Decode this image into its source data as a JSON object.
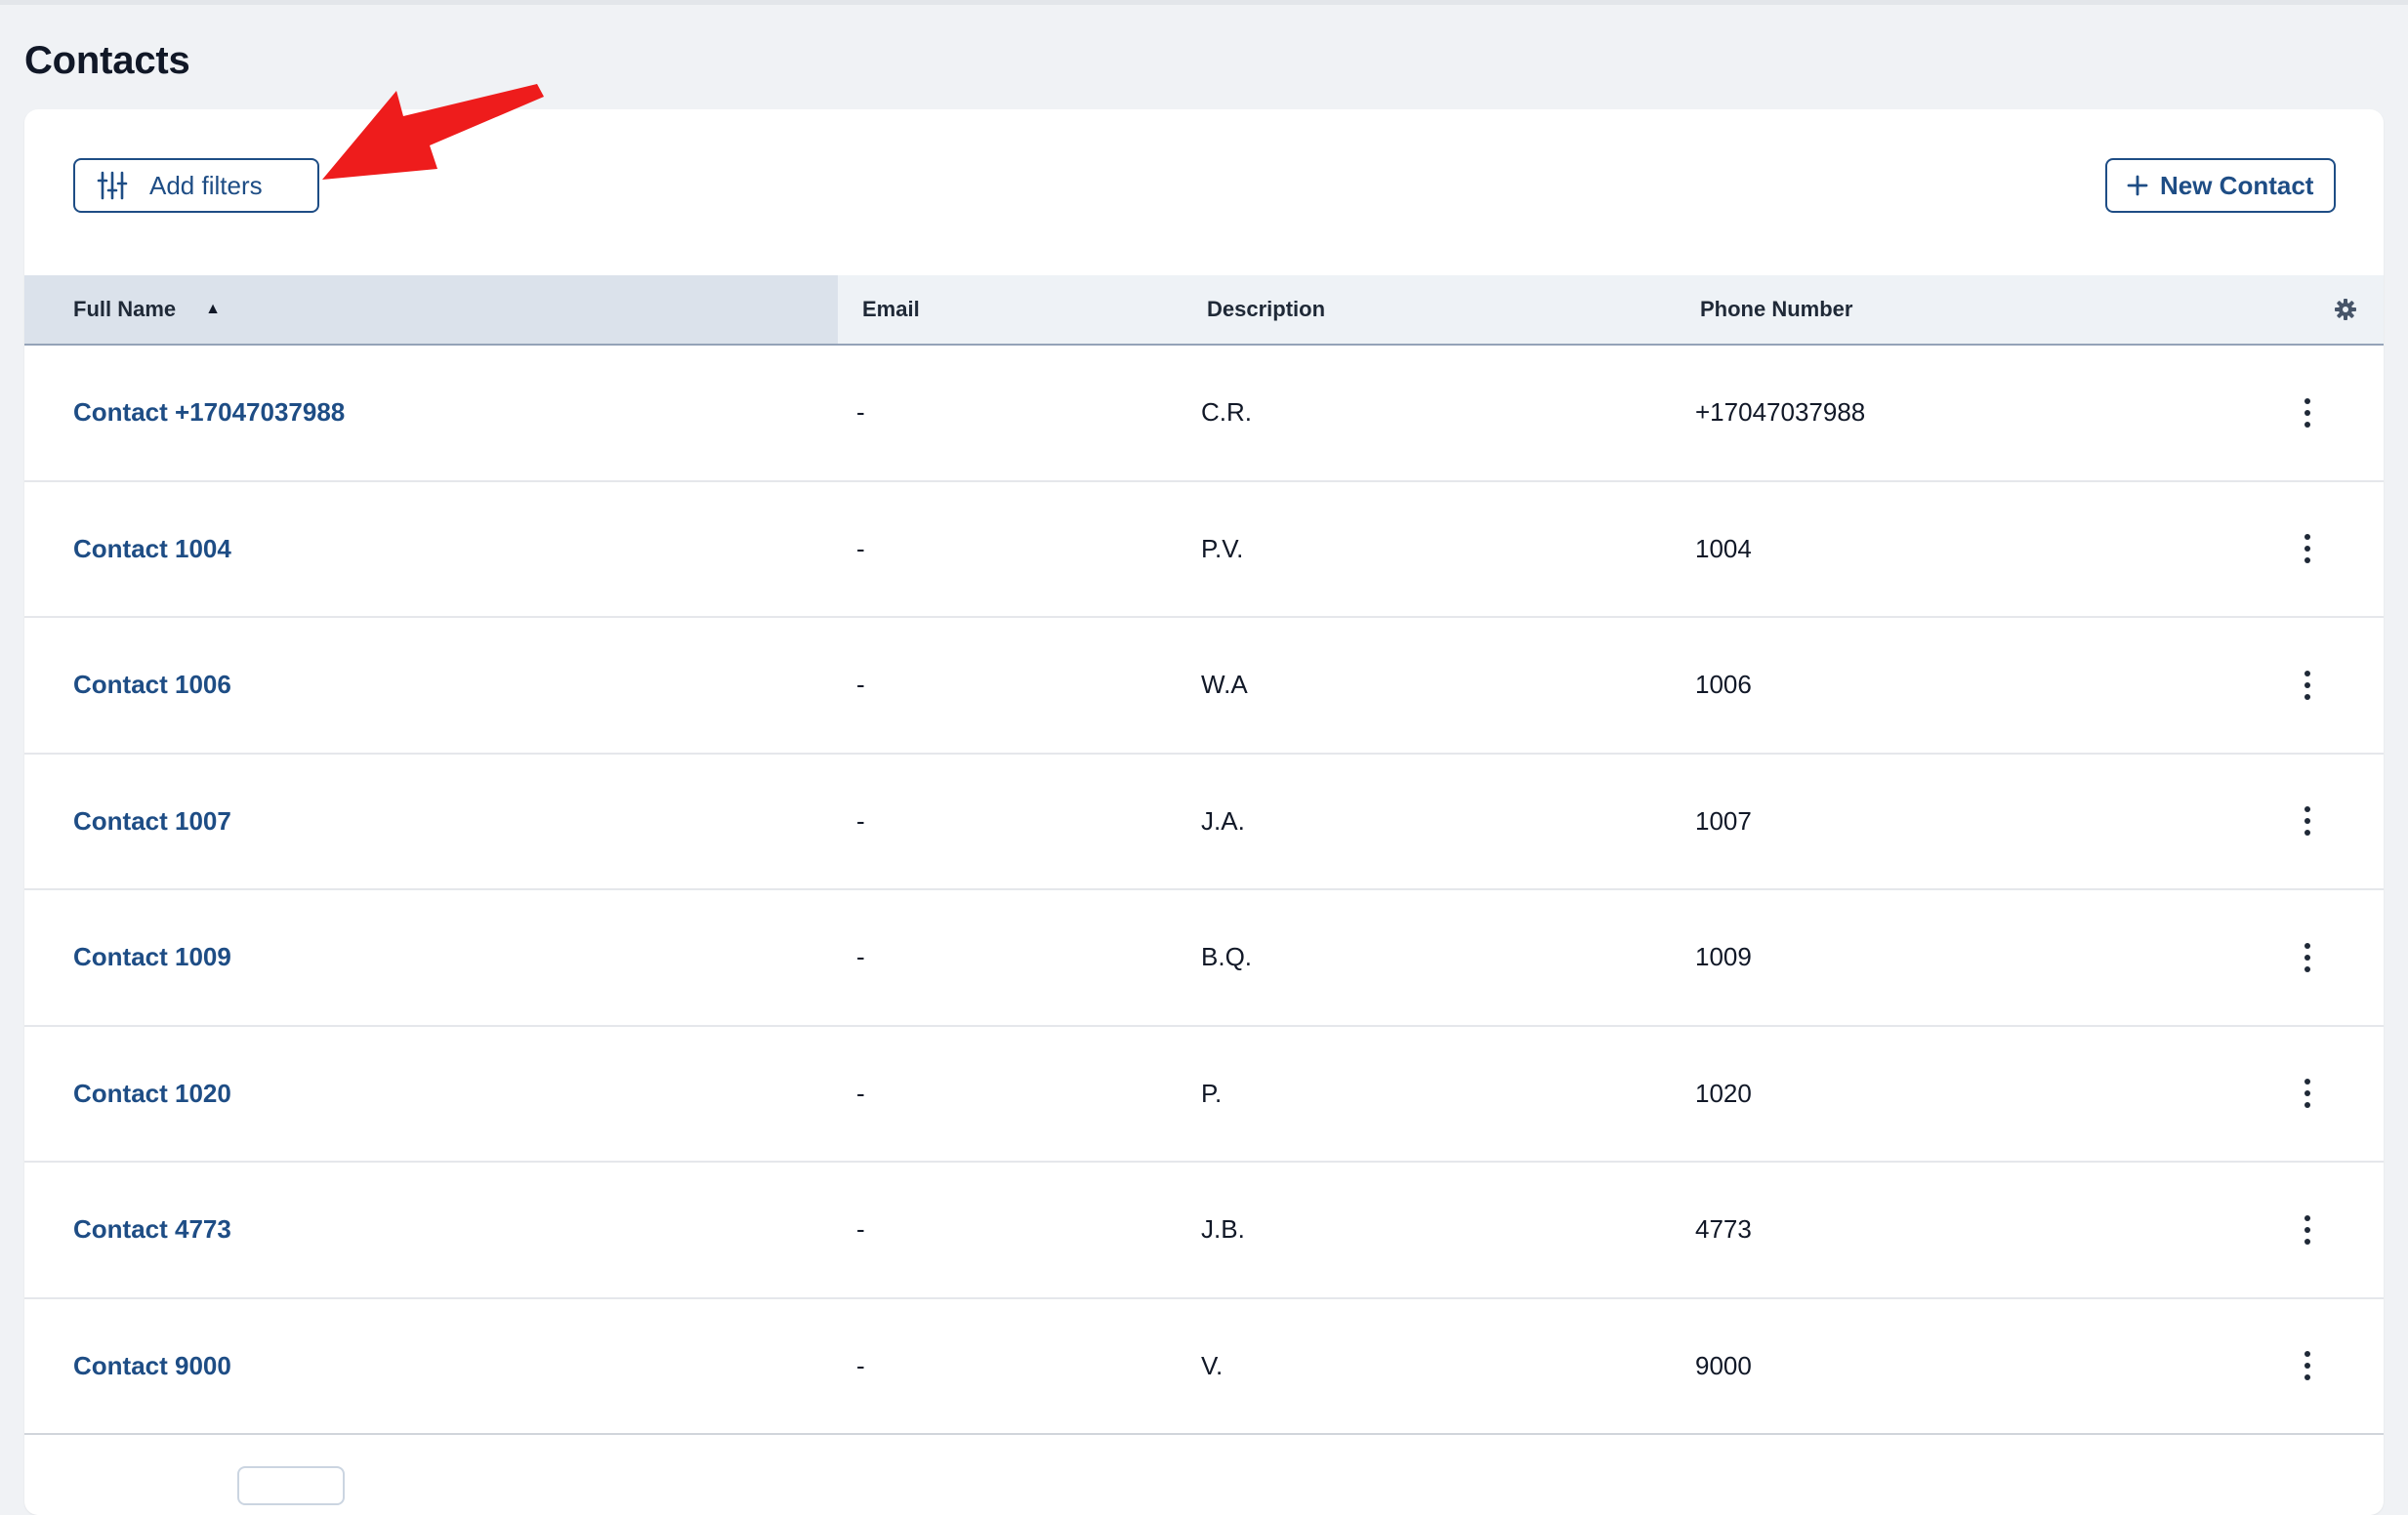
{
  "page": {
    "title": "Contacts"
  },
  "toolbar": {
    "filters_label": "Add filters",
    "new_contact_label": "New Contact"
  },
  "table": {
    "columns": [
      "Full Name",
      "Email",
      "Description",
      "Phone Number"
    ],
    "sort_indicator": "▲",
    "rows": [
      {
        "name": "Contact +17047037988",
        "email": "-",
        "description": "C.R.",
        "phone": "+17047037988"
      },
      {
        "name": "Contact 1004",
        "email": "-",
        "description": "P.V.",
        "phone": "1004"
      },
      {
        "name": "Contact 1006",
        "email": "-",
        "description": "W.A",
        "phone": "1006"
      },
      {
        "name": "Contact 1007",
        "email": "-",
        "description": "J.A.",
        "phone": "1007"
      },
      {
        "name": "Contact 1009",
        "email": "-",
        "description": "B.Q.",
        "phone": "1009"
      },
      {
        "name": "Contact 1020",
        "email": "-",
        "description": "P.",
        "phone": "1020"
      },
      {
        "name": "Contact 4773",
        "email": "-",
        "description": "J.B.",
        "phone": "4773"
      },
      {
        "name": "Contact 9000",
        "email": "-",
        "description": "V.",
        "phone": "9000"
      }
    ]
  },
  "icons": {
    "filters": "sliders-icon",
    "new_contact": "plus-icon",
    "settings": "gear-icon",
    "row_menu": "kebab-menu-icon",
    "annotation": "red-arrow-icon"
  },
  "colors": {
    "accent": "#1e4d85",
    "annotation_arrow": "#ee1c1c",
    "header_bg": "#eef2f6",
    "sorted_header_bg": "#dbe2eb",
    "page_bg": "#f0f2f5"
  }
}
